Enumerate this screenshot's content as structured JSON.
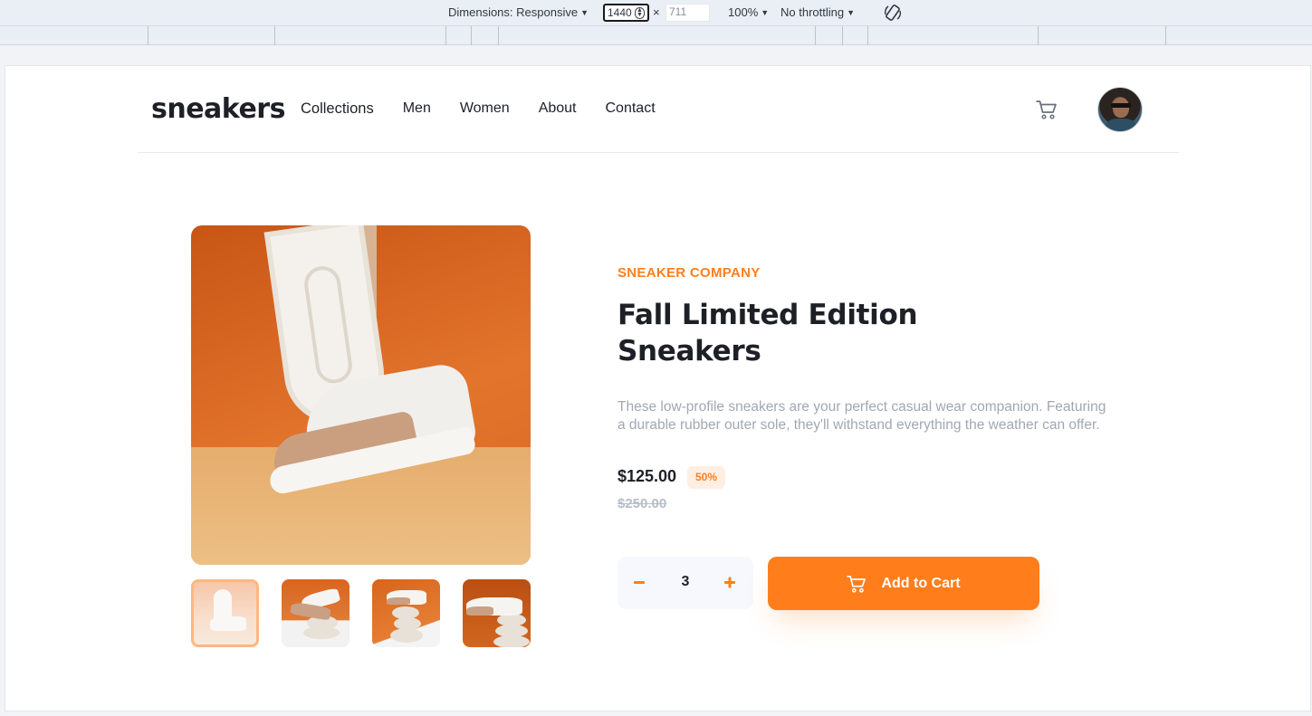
{
  "devtools": {
    "dimensions_label": "Dimensions: Responsive",
    "width_value": "1440",
    "times_sign": "×",
    "height_value": "711",
    "zoom_label": "100%",
    "throttling_label": "No throttling"
  },
  "nav": {
    "logo": "sneakers",
    "links": [
      "Collections",
      "Men",
      "Women",
      "About",
      "Contact"
    ]
  },
  "product": {
    "company": "SNEAKER COMPANY",
    "title_line1": "Fall Limited Edition",
    "title_line2": "Sneakers",
    "description": "These low-profile sneakers are your perfect casual wear companion. Featuring a durable rubber outer sole, they'll withstand everything the weather can offer.",
    "price": "$125.00",
    "discount": "50%",
    "old_price": "$250.00",
    "quantity": "3",
    "add_to_cart_label": "Add to Cart",
    "active_thumbnail": 1
  },
  "colors": {
    "accent": "#ff7e1b",
    "text_dark": "#1d2026",
    "text_muted": "#a1a7b3"
  },
  "icons": [
    "cart-icon",
    "minus-icon",
    "plus-icon",
    "rotate-icon"
  ]
}
